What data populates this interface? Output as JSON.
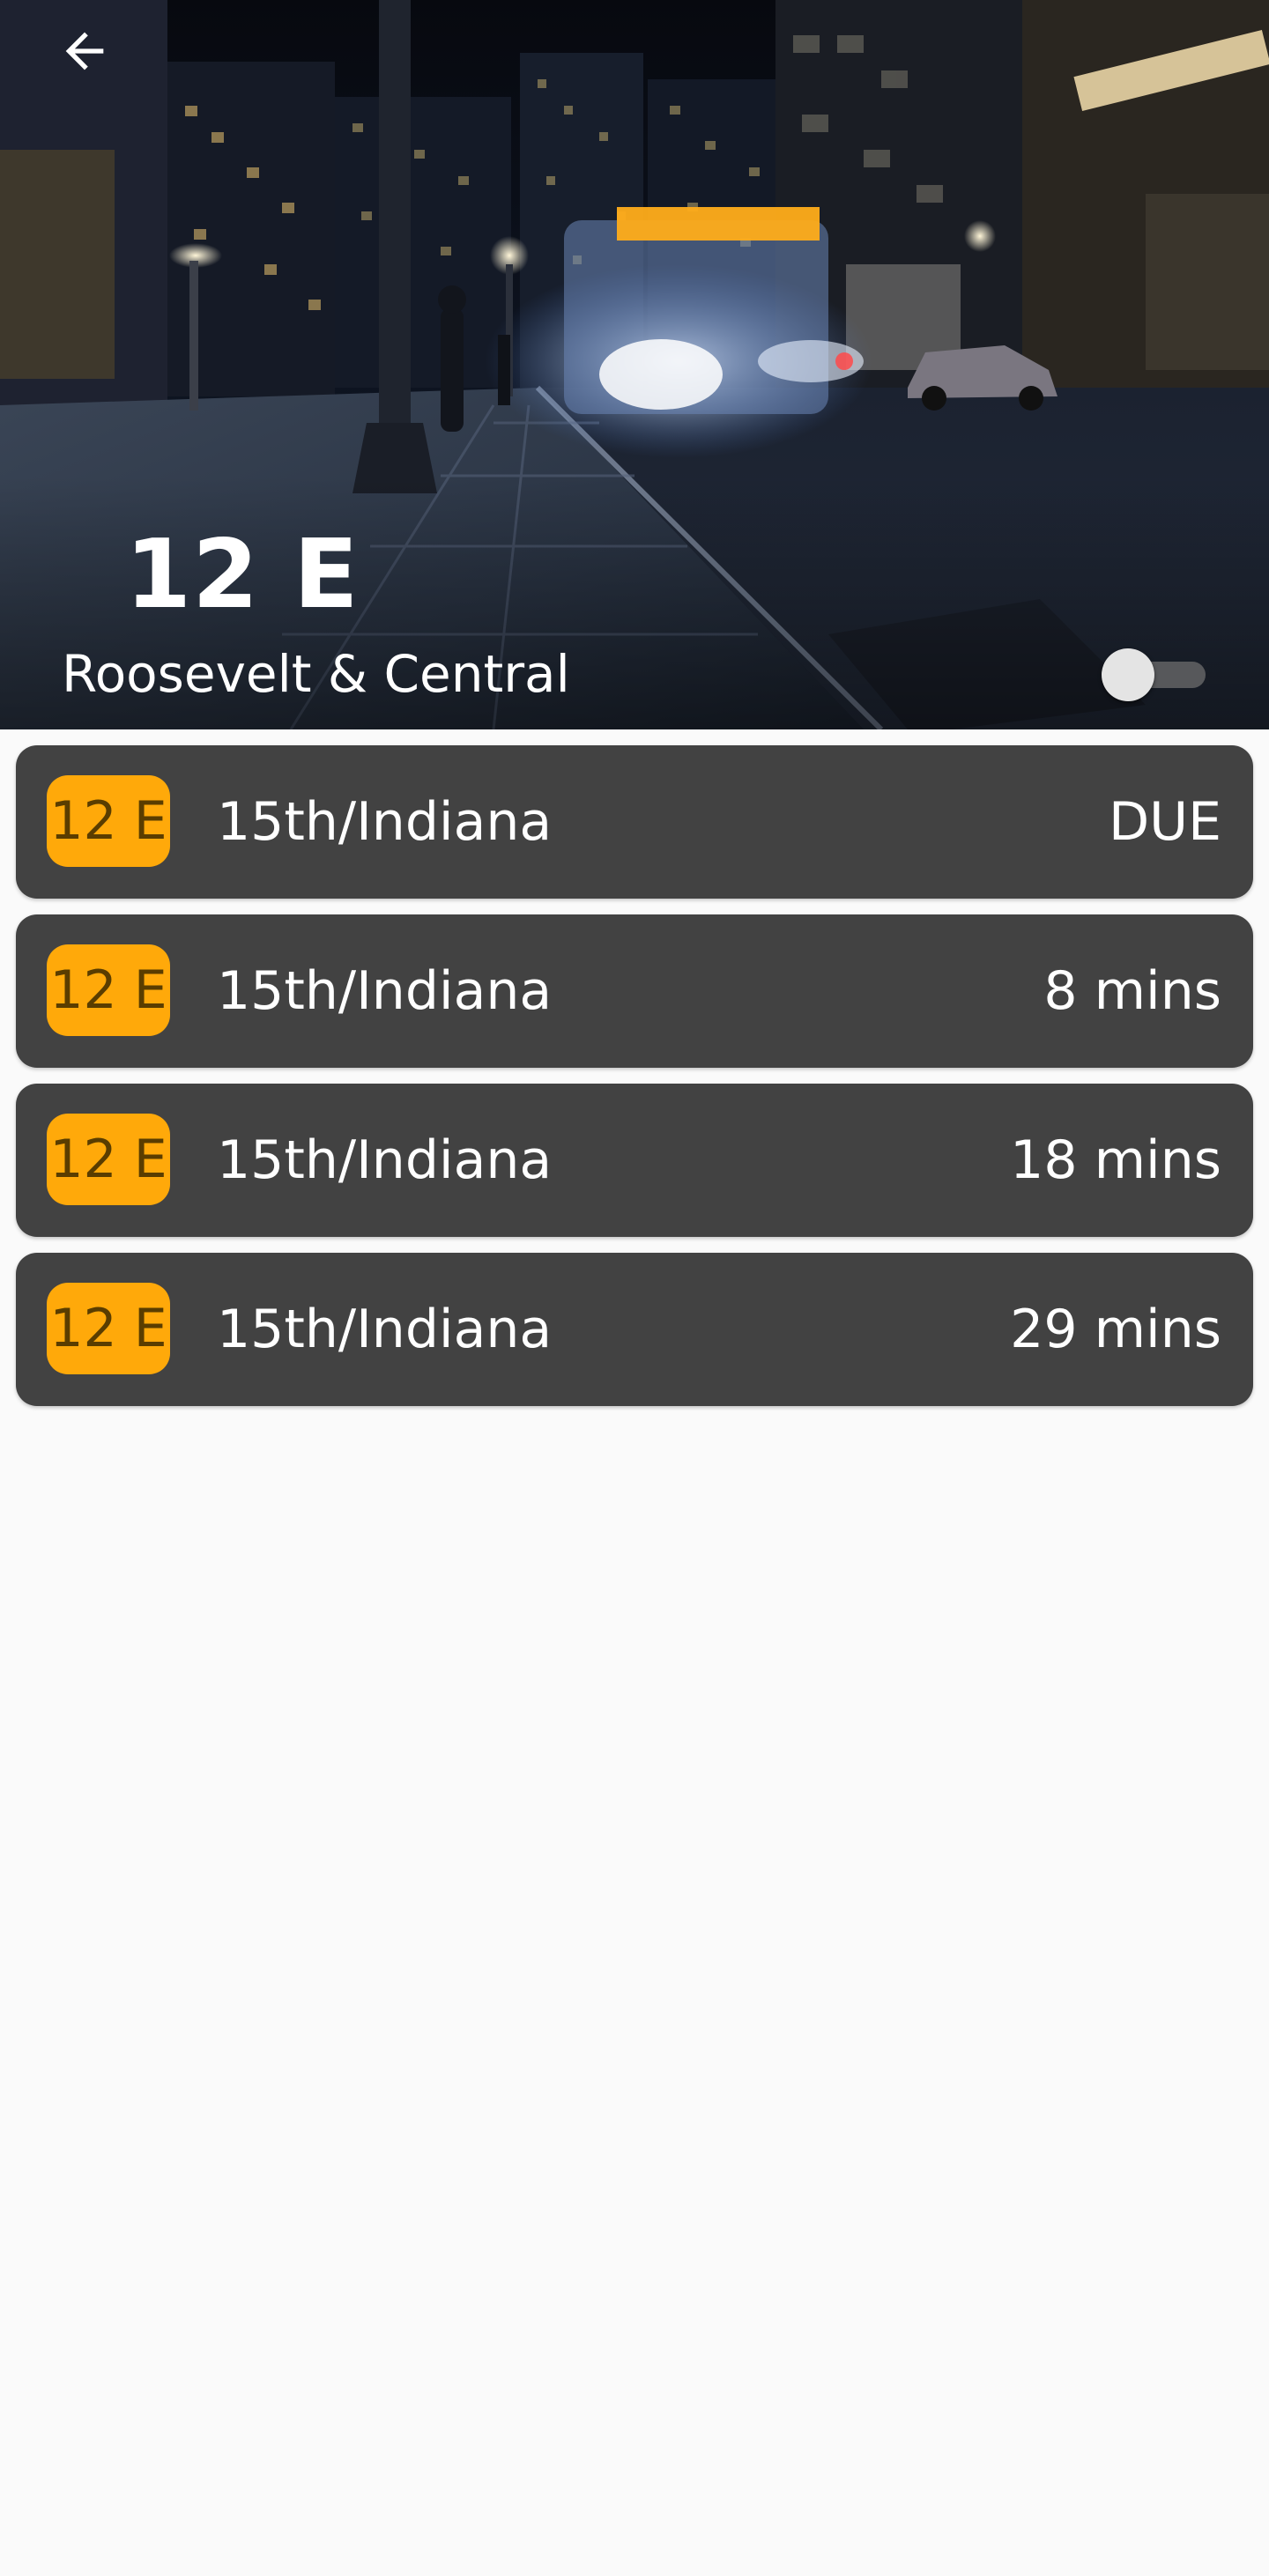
{
  "app": {
    "colors": {
      "accent": "#ffa90a",
      "card_background": "#424242",
      "page_background": "#fafafa",
      "header_text": "#ffffff"
    }
  },
  "header": {
    "back_icon": "arrow-left-icon",
    "route": "12 E",
    "stop_name": "Roosevelt & Central",
    "background_image": "night-city-street-bus-photo",
    "toggle": {
      "state": "off"
    }
  },
  "arrivals": [
    {
      "route": "12 E",
      "destination": "15th/Indiana",
      "eta": "DUE"
    },
    {
      "route": "12 E",
      "destination": "15th/Indiana",
      "eta": "8 mins"
    },
    {
      "route": "12 E",
      "destination": "15th/Indiana",
      "eta": "18 mins"
    },
    {
      "route": "12 E",
      "destination": "15th/Indiana",
      "eta": "29 mins"
    }
  ]
}
